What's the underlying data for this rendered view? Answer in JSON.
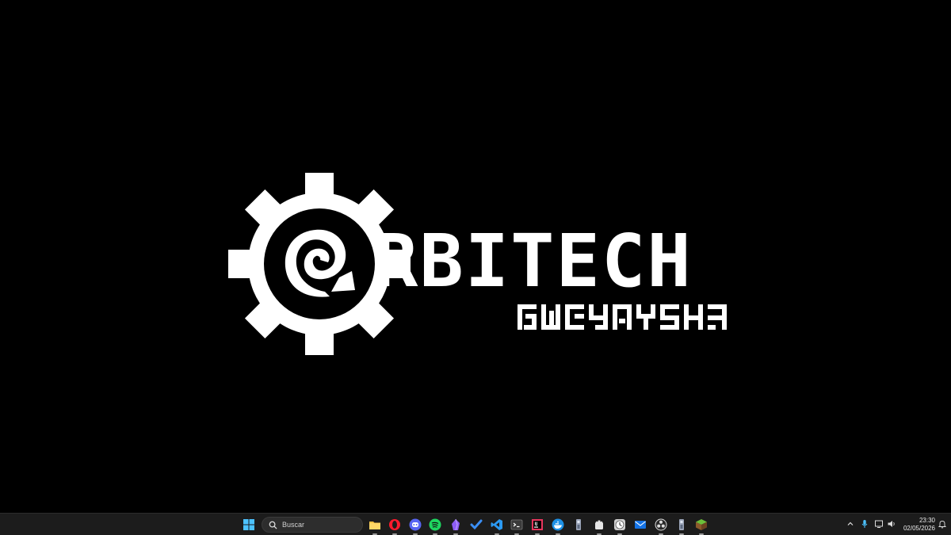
{
  "logo": {
    "wordmark": "RBITECH",
    "icon": "gear-with-swirl-o"
  },
  "taskbar": {
    "search_placeholder": "Buscar",
    "apps": [
      {
        "name": "start-icon",
        "running": false
      },
      {
        "name": "search-icon"
      },
      {
        "name": "file-explorer-icon",
        "running": true
      },
      {
        "name": "opera-icon",
        "running": true
      },
      {
        "name": "discord-icon",
        "running": true
      },
      {
        "name": "spotify-icon",
        "running": true
      },
      {
        "name": "obsidian-icon",
        "running": true
      },
      {
        "name": "todo-icon",
        "running": false
      },
      {
        "name": "vscode-icon",
        "running": true
      },
      {
        "name": "terminal-icon",
        "running": true
      },
      {
        "name": "jetbrains-icon",
        "running": true
      },
      {
        "name": "docker-icon",
        "running": true
      },
      {
        "name": "pin-app-icon",
        "running": false
      },
      {
        "name": "android-icon",
        "running": true
      },
      {
        "name": "clock-app-icon",
        "running": true
      },
      {
        "name": "mail-icon",
        "running": false
      },
      {
        "name": "obs-icon",
        "running": true
      },
      {
        "name": "pin-app-2-icon",
        "running": true
      },
      {
        "name": "minecraft-icon",
        "running": true
      }
    ],
    "tray": {
      "time": "23:30",
      "date": "02/05/2026"
    }
  },
  "colors": {
    "background": "#000000",
    "taskbar": "#1c1c1c",
    "logo": "#ffffff"
  }
}
